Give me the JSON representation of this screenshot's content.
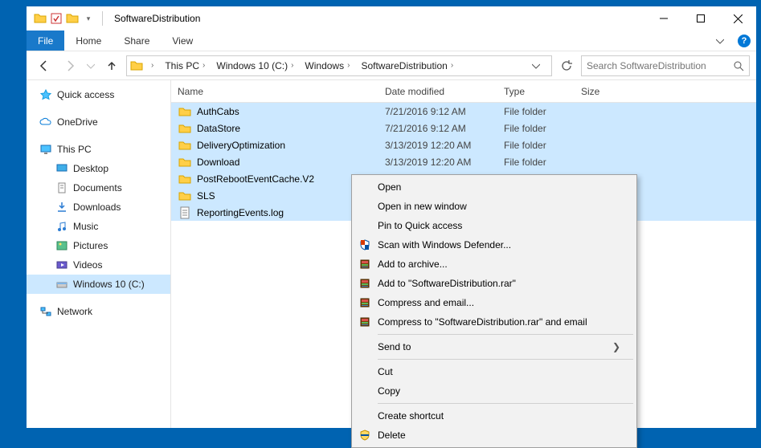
{
  "window": {
    "title": "SoftwareDistribution"
  },
  "ribbon": {
    "file": "File",
    "home": "Home",
    "share": "Share",
    "view": "View"
  },
  "breadcrumb": [
    "This PC",
    "Windows 10 (C:)",
    "Windows",
    "SoftwareDistribution"
  ],
  "search": {
    "placeholder": "Search SoftwareDistribution"
  },
  "columns": {
    "name": "Name",
    "date": "Date modified",
    "type": "Type",
    "size": "Size"
  },
  "nav": {
    "quick": "Quick access",
    "onedrive": "OneDrive",
    "thispc": "This PC",
    "desktop": "Desktop",
    "documents": "Documents",
    "downloads": "Downloads",
    "music": "Music",
    "pictures": "Pictures",
    "videos": "Videos",
    "cdrive": "Windows 10 (C:)",
    "network": "Network"
  },
  "files": [
    {
      "name": "AuthCabs",
      "date": "7/21/2016 9:12 AM",
      "type": "File folder",
      "icon": "folder",
      "sel": true
    },
    {
      "name": "DataStore",
      "date": "7/21/2016 9:12 AM",
      "type": "File folder",
      "icon": "folder",
      "sel": true
    },
    {
      "name": "DeliveryOptimization",
      "date": "3/13/2019 12:20 AM",
      "type": "File folder",
      "icon": "folder",
      "sel": true
    },
    {
      "name": "Download",
      "date": "3/13/2019 12:20 AM",
      "type": "File folder",
      "icon": "folder",
      "sel": true
    },
    {
      "name": "PostRebootEventCache.V2",
      "date": "",
      "type": "",
      "icon": "folder",
      "sel": true
    },
    {
      "name": "SLS",
      "date": "",
      "type": "",
      "icon": "folder",
      "sel": true
    },
    {
      "name": "ReportingEvents.log",
      "date": "",
      "type": "",
      "icon": "file",
      "sel": true
    }
  ],
  "context": {
    "open": "Open",
    "open_new": "Open in new window",
    "pin": "Pin to Quick access",
    "defender": "Scan with Windows Defender...",
    "add_archive": "Add to archive...",
    "add_rar": "Add to \"SoftwareDistribution.rar\"",
    "compress_email": "Compress and email...",
    "compress_rar_email": "Compress to \"SoftwareDistribution.rar\" and email",
    "send_to": "Send to",
    "cut": "Cut",
    "copy": "Copy",
    "create_shortcut": "Create shortcut",
    "delete": "Delete"
  }
}
